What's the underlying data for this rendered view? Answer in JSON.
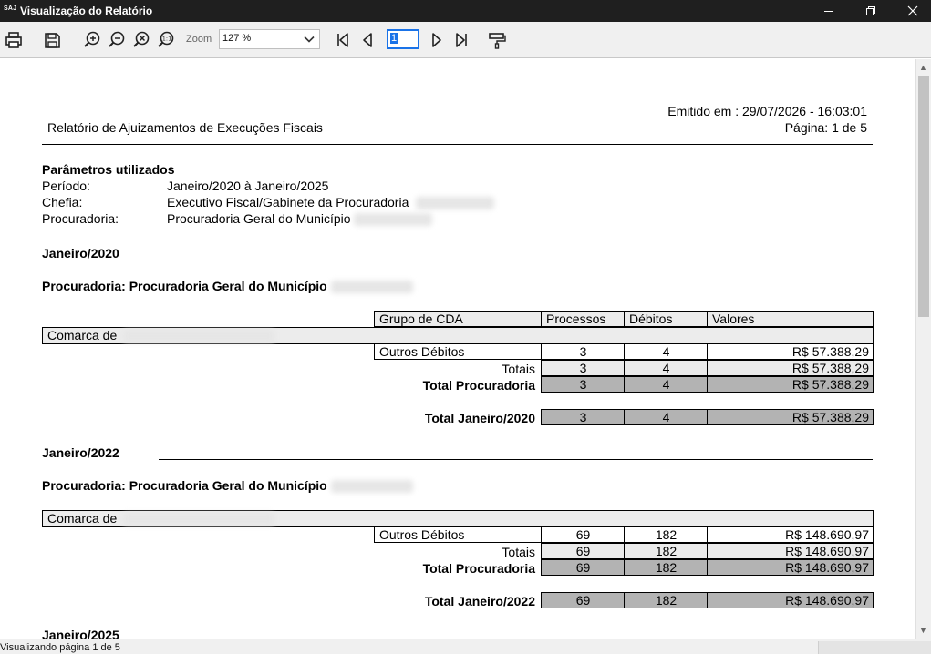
{
  "window": {
    "badge": "SAJ",
    "title": "Visualização do Relatório"
  },
  "toolbar": {
    "zoom_label": "Zoom",
    "zoom_value": "127 %",
    "page_value": "1"
  },
  "status": {
    "message": "Visualizando página 1 de 5"
  },
  "report": {
    "issued": "Emitido em : 29/07/2026 - 16:03:01",
    "title": "Relatório de Ajuizamentos de Execuções Fiscais",
    "page": "Página: 1 de 5",
    "params_heading": "Parâmetros utilizados",
    "params": [
      {
        "label": "Período:",
        "value": "Janeiro/2020 à Janeiro/2025"
      },
      {
        "label": "Chefia:",
        "value": "Executivo Fiscal/Gabinete da Procuradoria"
      },
      {
        "label": "Procuradoria:",
        "value": "Procuradoria Geral do Município"
      }
    ],
    "table_headers": [
      "Grupo de CDA",
      "Processos",
      "Débitos",
      "Valores"
    ],
    "comarca_label": "Comarca de",
    "sections": [
      {
        "period": "Janeiro/2020",
        "procuradoria": "Procuradoria: Procuradoria Geral do Município",
        "row": {
          "grupo": "Outros Débitos",
          "processos": "3",
          "debitos": "4",
          "valores": "R$ 57.388,29"
        },
        "totais": {
          "label": "Totais",
          "processos": "3",
          "debitos": "4",
          "valores": "R$ 57.388,29"
        },
        "total_proc": {
          "label": "Total Procuradoria",
          "processos": "3",
          "debitos": "4",
          "valores": "R$ 57.388,29"
        },
        "total_period": {
          "label": "Total Janeiro/2020",
          "processos": "3",
          "debitos": "4",
          "valores": "R$ 57.388,29"
        }
      },
      {
        "period": "Janeiro/2022",
        "procuradoria": "Procuradoria: Procuradoria Geral do Município",
        "row": {
          "grupo": "Outros Débitos",
          "processos": "69",
          "debitos": "182",
          "valores": "R$ 148.690,97"
        },
        "totais": {
          "label": "Totais",
          "processos": "69",
          "debitos": "182",
          "valores": "R$ 148.690,97"
        },
        "total_proc": {
          "label": "Total Procuradoria",
          "processos": "69",
          "debitos": "182",
          "valores": "R$ 148.690,97"
        },
        "total_period": {
          "label": "Total Janeiro/2022",
          "processos": "69",
          "debitos": "182",
          "valores": "R$ 148.690,97"
        }
      },
      {
        "period": "Janeiro/2025"
      }
    ]
  }
}
